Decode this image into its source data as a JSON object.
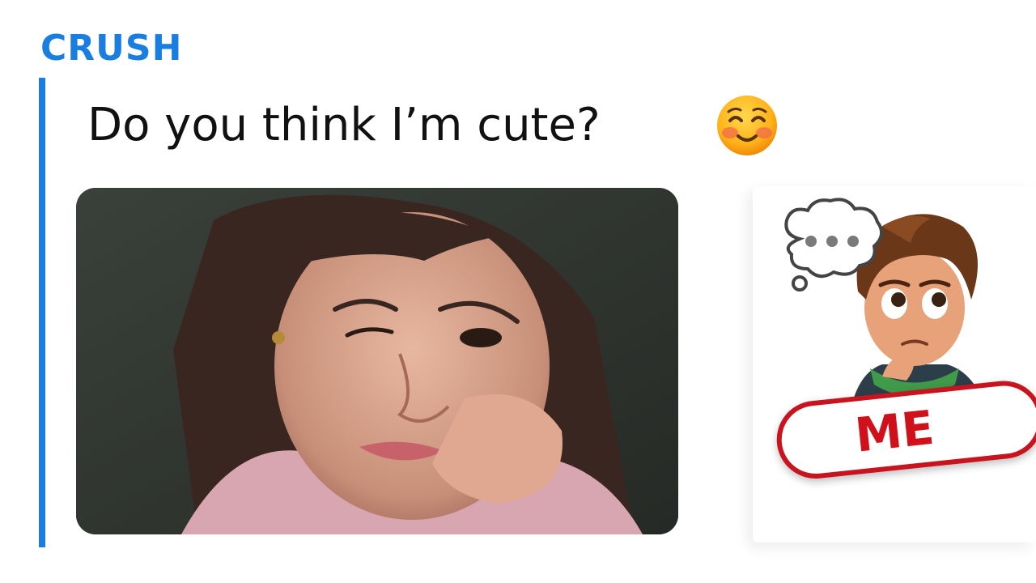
{
  "sender": {
    "name": "CRUSH"
  },
  "message": {
    "text": "Do you think I’m cute?",
    "emoji": "smiling-face-icon"
  },
  "photo": {
    "alt_icon": "selfie-photo"
  },
  "reply_indicator": {
    "typing_icon": "thought-bubble-typing-icon"
  },
  "badge": {
    "label": "ME"
  },
  "colors": {
    "accent": "#1a7de0",
    "badge_red": "#d0101a"
  }
}
